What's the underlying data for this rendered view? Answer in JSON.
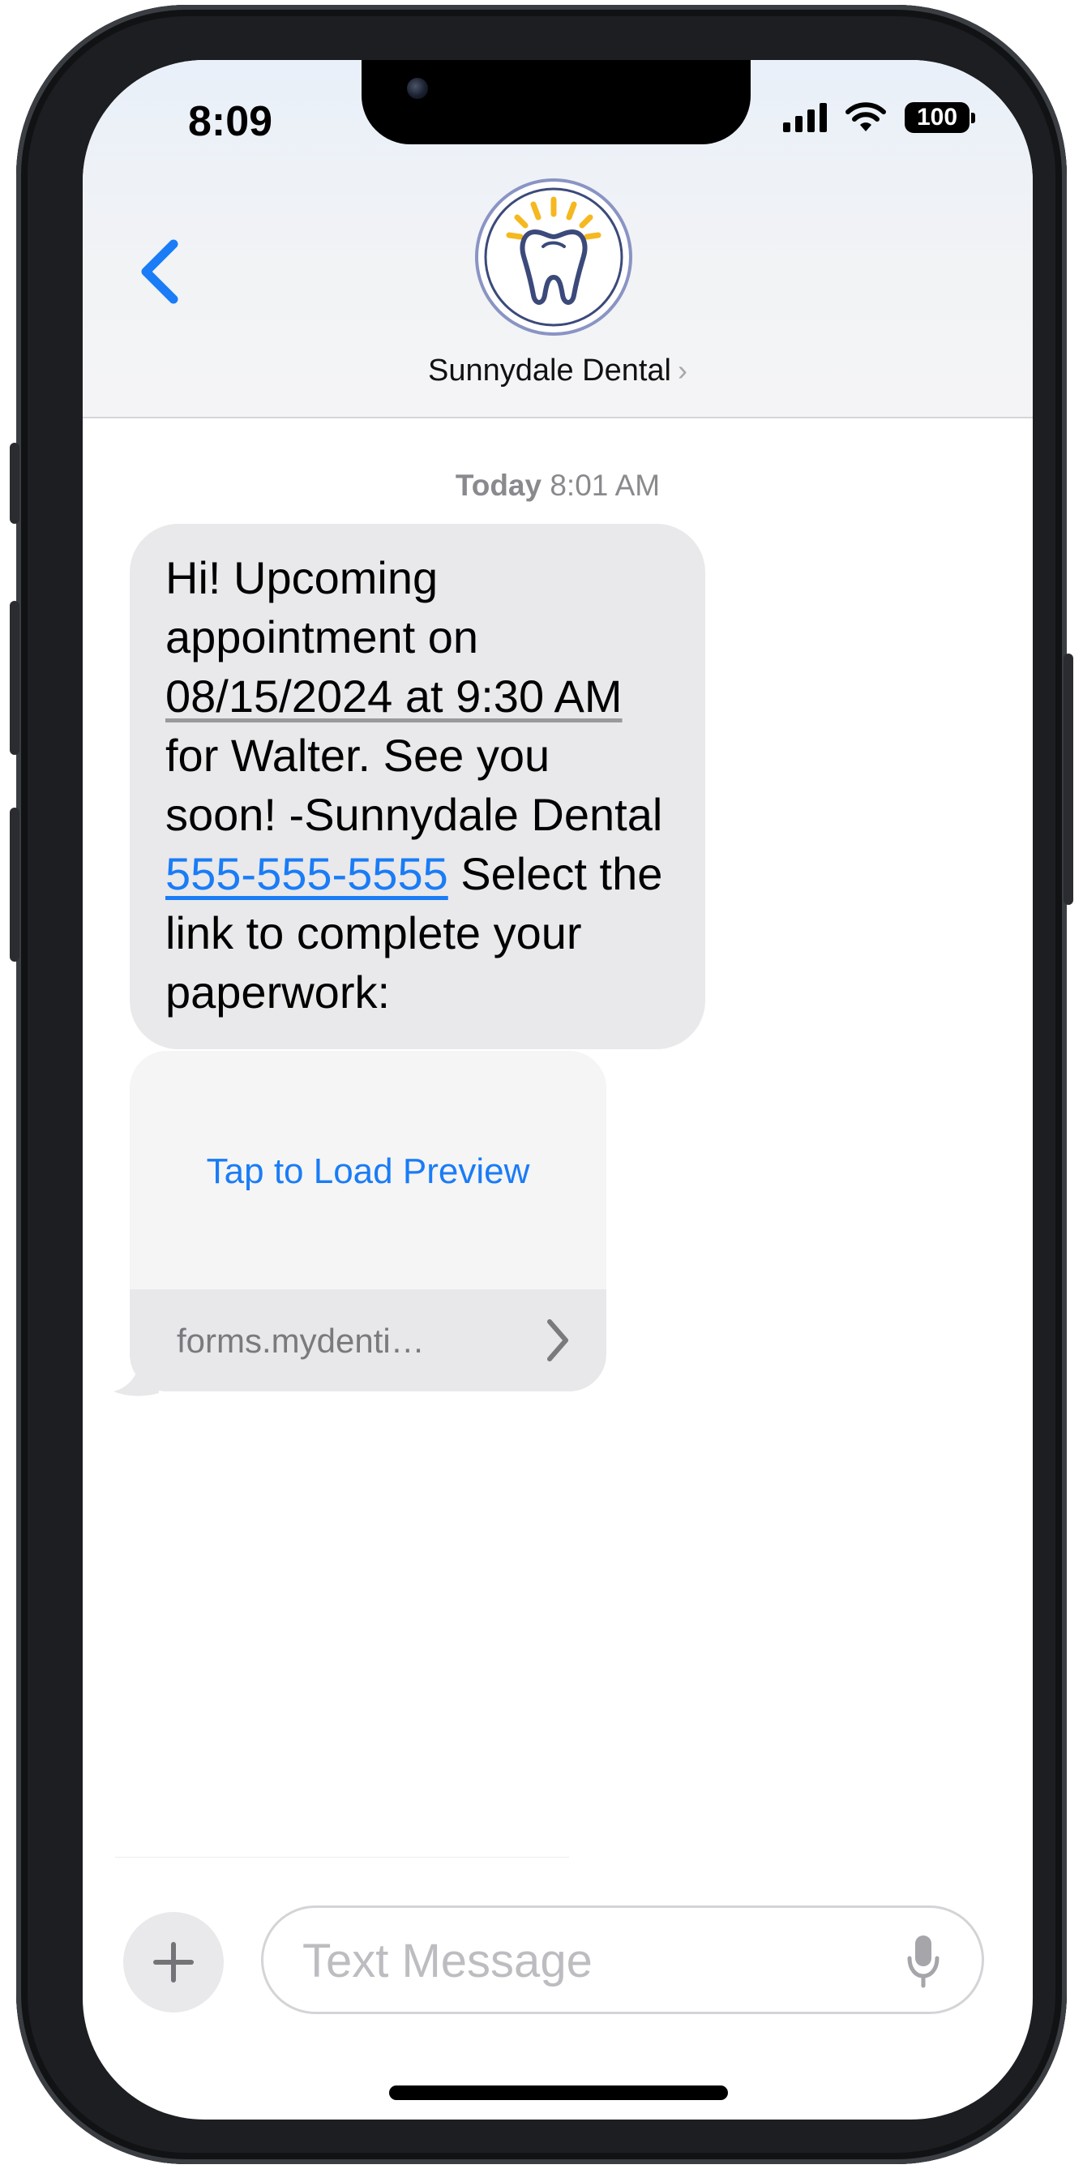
{
  "status_bar": {
    "time": "8:09",
    "battery": "100"
  },
  "header": {
    "contact_name": "Sunnydale Dental",
    "contact_chevron": "›",
    "icons": [
      "back-chevron-icon",
      "tooth-logo-icon"
    ]
  },
  "conversation": {
    "timestamp_day": "Today",
    "timestamp_time": "8:01 AM",
    "message": {
      "line1": "Hi! Upcoming appointment on",
      "date_link": "08/15/2024 at 9:30 AM",
      "line2": " for Walter. See you soon! -Sunnydale Dental ",
      "phone_link": "555-555-5555",
      "line3": " Select the link to complete your paperwork:"
    },
    "link_preview": {
      "preview_label": "Tap to Load Preview",
      "domain": "forms.mydenti…"
    }
  },
  "composer": {
    "placeholder": "Text Message",
    "value": ""
  },
  "colors": {
    "link_blue": "#1a7cf6",
    "bubble_gray": "#e9e9eb",
    "logo_ring": "#8a94c4",
    "logo_rays": "#f5b820",
    "tooth_stroke": "#3b4a7a"
  }
}
